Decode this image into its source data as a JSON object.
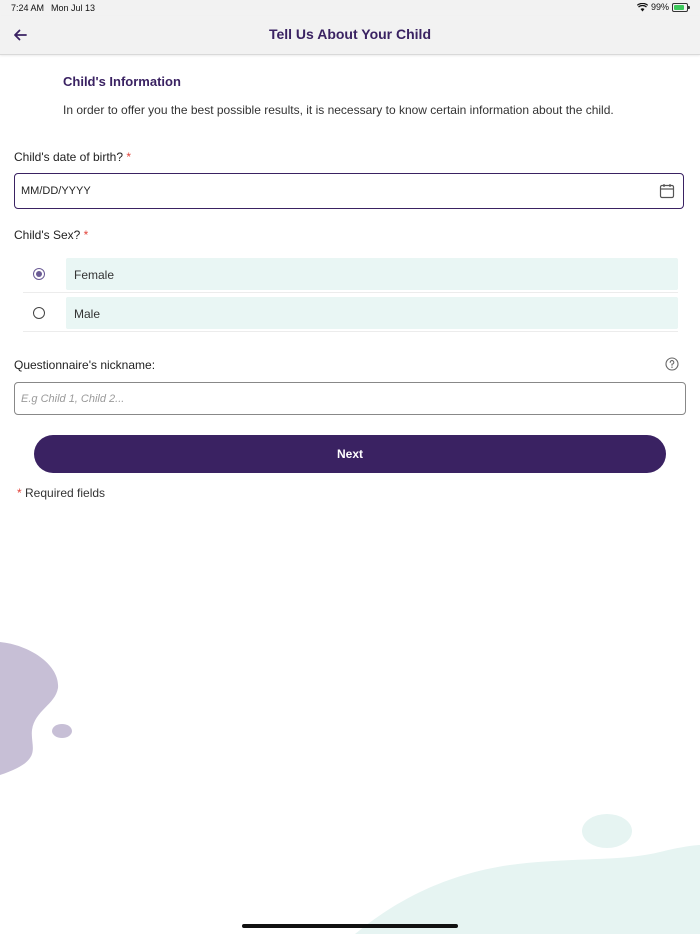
{
  "status_bar": {
    "time": "7:24 AM",
    "date": "Mon Jul 13",
    "battery": "99%"
  },
  "nav": {
    "title": "Tell Us About Your Child",
    "back_icon": "arrow-left-icon"
  },
  "info": {
    "title": "Child's Information",
    "description": "In order to offer you the best possible results, it is necessary to know certain information about the child."
  },
  "form": {
    "dob": {
      "label": "Child's date of birth?",
      "required_marker": "*",
      "value": "MM/DD/YYYY",
      "icon": "calendar-icon"
    },
    "sex": {
      "label": "Child's Sex?",
      "required_marker": "*",
      "options": [
        {
          "label": "Female",
          "selected": true
        },
        {
          "label": "Male",
          "selected": false
        }
      ]
    },
    "nickname": {
      "label": "Questionnaire's nickname:",
      "placeholder": "E.g Child 1, Child 2...",
      "help_icon": "help-icon"
    },
    "next_label": "Next",
    "required_note": {
      "marker": "*",
      "text": "Required fields"
    }
  },
  "colors": {
    "primary": "#3a2262",
    "accent_radio": "#6b5b95",
    "option_bg": "#e9f6f4",
    "required": "#e2443b",
    "blob_purple": "#c7bfd6",
    "blob_teal": "#e6f4f2"
  }
}
